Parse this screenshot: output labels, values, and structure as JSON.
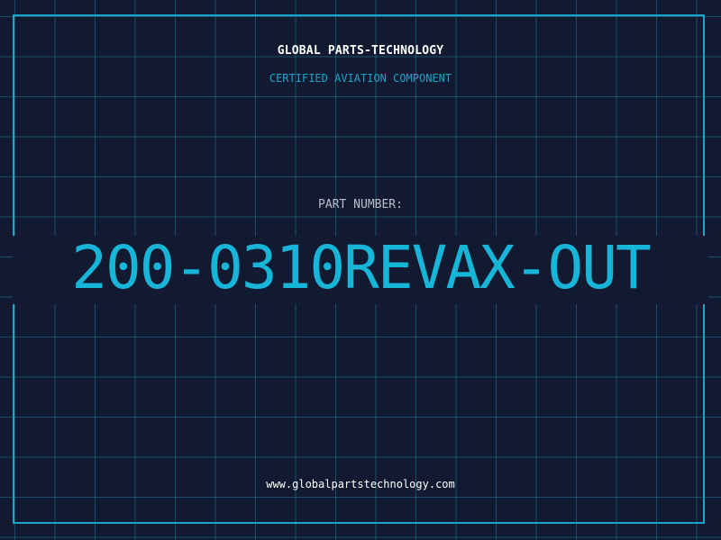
{
  "header": {
    "company": "GLOBAL PARTS-TECHNOLOGY",
    "tagline": "CERTIFIED AVIATION COMPONENT"
  },
  "part": {
    "label": "PART NUMBER:",
    "number": "200-0310REVAX-OUT"
  },
  "footer": {
    "website": "www.globalpartstechnology.com"
  },
  "colors": {
    "background": "#111a30",
    "grid": "#227896",
    "accent": "#1aa6c9",
    "text": "#ffffff"
  }
}
